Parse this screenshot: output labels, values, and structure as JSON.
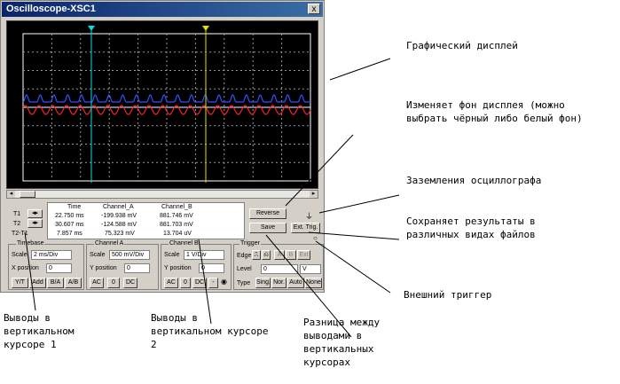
{
  "window": {
    "title": "Oscilloscope-XSC1",
    "close": "x"
  },
  "cursors": {
    "t1": "T1",
    "t2": "T2",
    "diff": "T2-T1"
  },
  "readout": {
    "headers": [
      "Time",
      "Channel_A",
      "Channel_B"
    ],
    "rows": [
      [
        "22.750 ms",
        "-199.938 mV",
        "881.746 mV"
      ],
      [
        "30.607 ms",
        "-124.588 mV",
        "881.703 mV"
      ],
      [
        "7.857 ms",
        "75.323 mV",
        "13.704 uV"
      ]
    ]
  },
  "buttons": {
    "reverse": "Reverse",
    "save": "Save",
    "ext_trig": "Ext. Trig."
  },
  "timebase": {
    "title": "Timebase",
    "scale_label": "Scale",
    "scale_value": "2 ms/Div",
    "xpos_label": "X position",
    "xpos_value": "0",
    "modes": [
      "Y/T",
      "Add",
      "B/A",
      "A/B"
    ]
  },
  "channel_a": {
    "title": "Channel A",
    "scale_label": "Scale",
    "scale_value": "500 mV/Div",
    "ypos_label": "Y position",
    "ypos_value": "0",
    "coupling": [
      "AC",
      "0",
      "DC"
    ]
  },
  "channel_b": {
    "title": "Channel B",
    "scale_label": "Scale",
    "scale_value": "1 V/Div",
    "ypos_label": "Y position",
    "ypos_value": "0",
    "coupling": [
      "AC",
      "0",
      "DC",
      "-"
    ]
  },
  "trigger": {
    "title": "Trigger",
    "edge_label": "Edge",
    "level_label": "Level",
    "level_value": "0",
    "level_unit": "V",
    "source": [
      "A",
      "B",
      "Ext"
    ],
    "type_label": "Type",
    "types": [
      "Sing.",
      "Nor.",
      "Auto",
      "None"
    ]
  },
  "annotations": {
    "display": "Графический дисплей",
    "background_1": "Изменяет фон дисплея (можно",
    "background_2": "выбрать чёрный либо белый фон)",
    "ground": "Заземления осциллографа",
    "save_1": "Сохраняет результаты в",
    "save_2": "различных видах файлов",
    "trigger": "Внешний триггер",
    "cursor1_1": "Выводы в",
    "cursor1_2": "вертикальном",
    "cursor1_3": "курсоре 1",
    "cursor2_1": "Выводы в",
    "cursor2_2": "вертикальном курсоре",
    "cursor2_3": "2",
    "diff_1": "Разница между",
    "diff_2": "выводами в",
    "diff_3": "вертикальных",
    "diff_4": "курсорах"
  },
  "colors": {
    "channel_a": "#ff2020",
    "channel_b": "#3050ff",
    "cursor_1": "#00e0e0",
    "cursor_2": "#e0e000"
  }
}
